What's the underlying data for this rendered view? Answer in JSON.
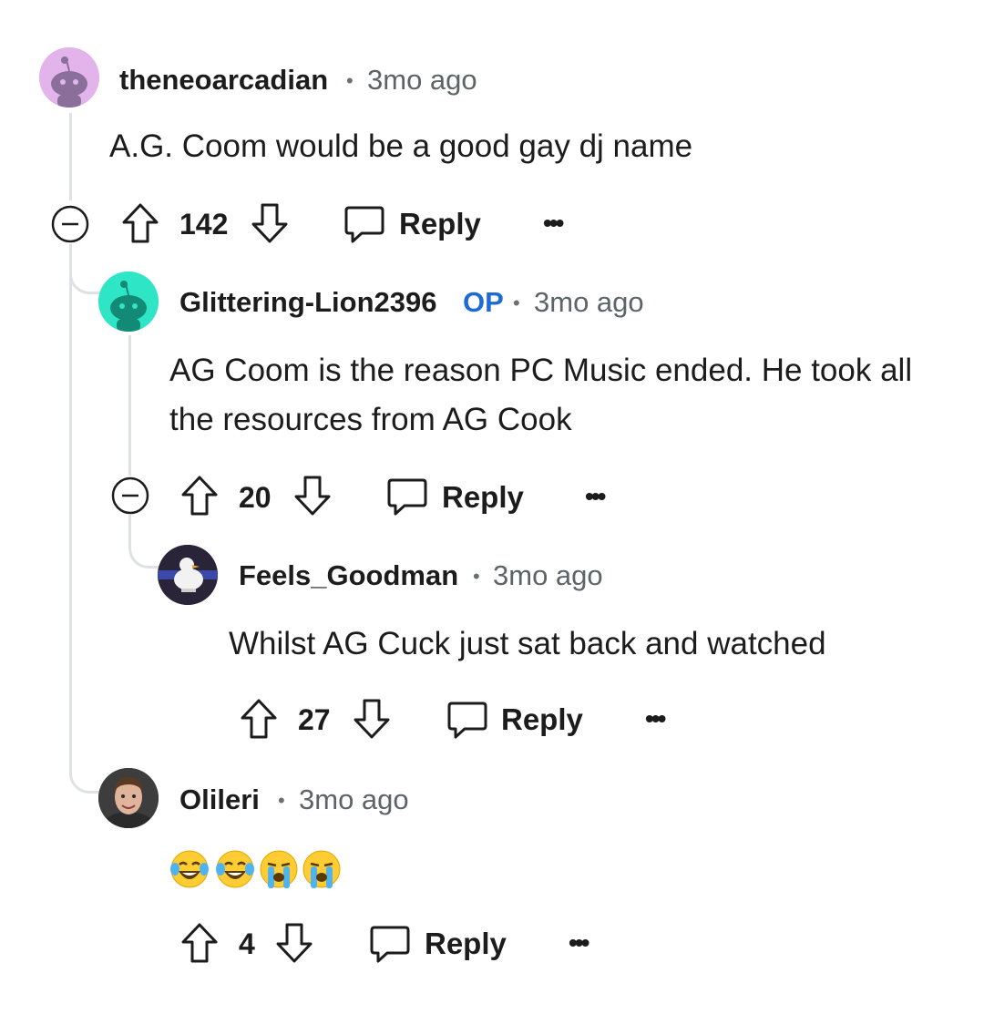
{
  "comments": [
    {
      "username": "theneoarcadian",
      "time": "3mo ago",
      "body": "A.G. Coom would be a good gay dj name",
      "score": "142",
      "reply_label": "Reply",
      "avatar_color": "#e3b3ec"
    },
    {
      "username": "Glittering-Lion2396",
      "op_badge": "OP",
      "time": "3mo ago",
      "body": "AG Coom is the reason PC Music ended. He took all the resources from AG Cook",
      "score": "20",
      "reply_label": "Reply",
      "avatar_color": "#2ee6c5"
    },
    {
      "username": "Feels_Goodman",
      "time": "3mo ago",
      "body": "Whilst AG Cuck just sat back and watched",
      "score": "27",
      "reply_label": "Reply",
      "avatar_color": "#2a2438"
    },
    {
      "username": "Olileri",
      "time": "3mo ago",
      "body_emojis": [
        "face-with-tears-of-joy",
        "face-with-tears-of-joy",
        "loudly-crying-face",
        "loudly-crying-face"
      ],
      "score": "4",
      "reply_label": "Reply",
      "avatar_color": "#3a3a3a"
    }
  ],
  "meta_separator": "•",
  "more_label": "•••",
  "colors": {
    "op": "#1f6bd6",
    "thread_line": "#dfe2e5",
    "text": "#1c1c1c",
    "muted": "#5c6468"
  }
}
